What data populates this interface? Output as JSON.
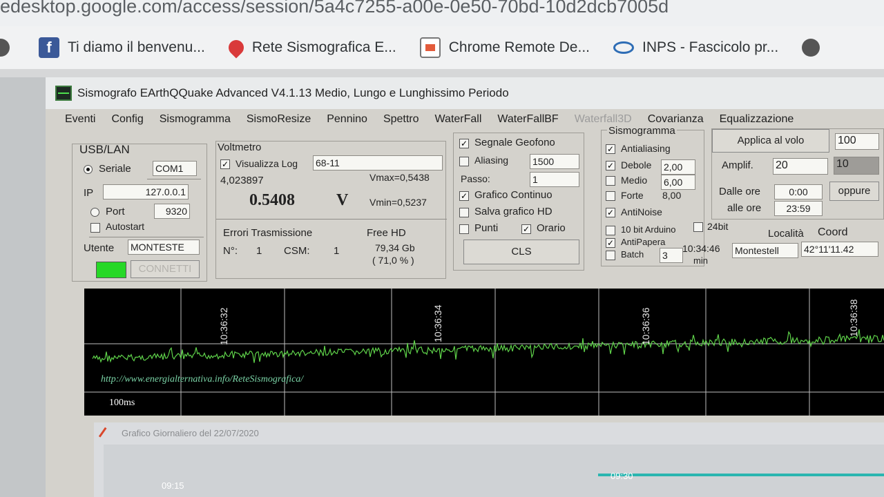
{
  "browser": {
    "url": "edesktop.google.com/access/session/5a4c7255-a00e-0e50-70bd-10d2dcb7005d",
    "bookmarks": [
      {
        "icon": "globe-icon",
        "label": ""
      },
      {
        "icon": "facebook-icon",
        "label": "Ti diamo il benvenu..."
      },
      {
        "icon": "map-pin-icon",
        "label": "Rete Sismografica E..."
      },
      {
        "icon": "chrome-remote-desktop-icon",
        "label": "Chrome Remote De..."
      },
      {
        "icon": "inps-icon",
        "label": "INPS - Fascicolo pr..."
      },
      {
        "icon": "globe-icon",
        "label": ""
      }
    ]
  },
  "app": {
    "title": "Sismografo EArthQQuake Advanced V4.1.13  Medio, Lungo e Lunghissimo Periodo",
    "menu": [
      "Eventi",
      "Config",
      "Sismogramma",
      "SismoResize",
      "Pennino",
      "Spettro",
      "WaterFall",
      "WaterFallBF",
      "Waterfall3D",
      "Covarianza",
      "Equalizzazione"
    ],
    "menu_disabled": "Waterfall3D"
  },
  "usb": {
    "title": "USB/LAN",
    "seriale_label": "Seriale",
    "com_value": "COM1",
    "ip_label": "IP",
    "ip_value": "127.0.0.1",
    "port_label": "Port",
    "port_value": "9320",
    "autostart_label": "Autostart",
    "utente_label": "Utente",
    "utente_value": "MONTESTE",
    "connect_label": "CONNETTI",
    "status_color": "#27d827"
  },
  "voltmetro": {
    "title": "Voltmetro",
    "visualizza_label": "Visualizza Log",
    "log_value": "68-11",
    "raw_value": "4,023897",
    "vmax": "Vmax=0,5438",
    "vmin": "Vmin=0,5237",
    "big_value": "0.5408",
    "unit": "V"
  },
  "errori": {
    "title": "Errori Trasmissione",
    "n_label": "N°:",
    "n_value": "1",
    "csm_label": "CSM:",
    "csm_value": "1"
  },
  "freehd": {
    "title": "Free HD",
    "size": "79,34 Gb",
    "pct": "( 71,0 % )"
  },
  "geofono": {
    "segnale_label": "Segnale Geofono",
    "aliasing_label": "Aliasing",
    "aliasing_value": "1500",
    "passo_label": "Passo:",
    "passo_value": "1",
    "grafico_label": "Grafico Continuo",
    "salva_label": "Salva grafico HD",
    "punti_label": "Punti",
    "orario_label": "Orario",
    "cls_label": "CLS"
  },
  "sismogramma": {
    "title": "Sismogramma",
    "antialiasing_label": "Antialiasing",
    "debole_label": "Debole",
    "debole_value": "2,00",
    "medio_label": "Medio",
    "medio_value": "6,00",
    "forte_label": "Forte",
    "forte_value": "8,00",
    "antinoise_label": "AntiNoise",
    "arduino_label": "10 bit Arduino",
    "bit24_label": "24bit",
    "antipapera_label": "AntiPapera",
    "batch_label": "Batch",
    "batch_value": "3",
    "time_value": "10:34:46",
    "min_label": "min"
  },
  "right": {
    "applica_label": "Applica al volo",
    "applica_value": "100",
    "amplif_label": "Amplif.",
    "amplif_value": "20",
    "amplif_value2": "10",
    "dalle_label": "Dalle ore",
    "dalle_value": "0:00",
    "alle_label": "alle ore",
    "alle_value": "23:59",
    "oppure_label": "oppure",
    "localita_label": "Località",
    "coord_label": "Coord",
    "localita_value": "Montestell",
    "coord_value": "42°11'11.42"
  },
  "seismogram": {
    "url": "http://www.energialternativa.info/ReteSismografica/",
    "scale_label": "100ms",
    "time_labels": [
      "10:36:32",
      "10:36:34",
      "10:36:36",
      "10:36:38"
    ],
    "trace_color": "#5fd34a"
  },
  "daily": {
    "title": "Grafico Giornaliero del 22/07/2020",
    "labels": [
      "09:15",
      "09:30"
    ],
    "line_color": "#2ab5b0"
  }
}
